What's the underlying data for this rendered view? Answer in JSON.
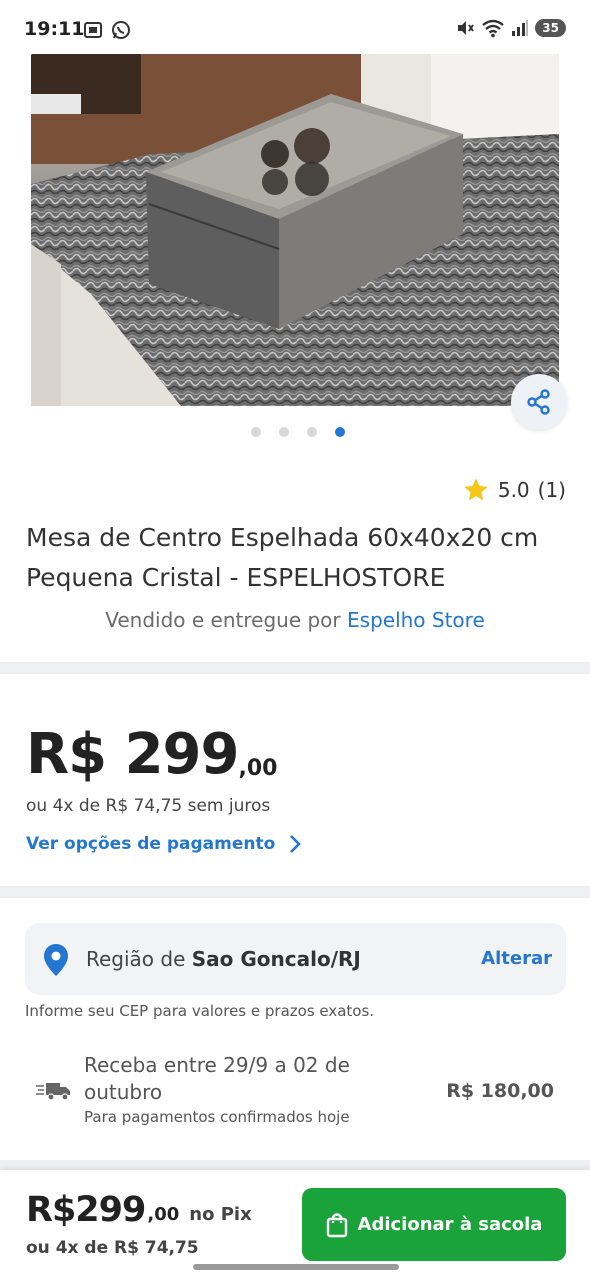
{
  "status_bar": {
    "time": "19:11",
    "battery": "35",
    "left_icons": [
      "screenshot-icon",
      "whatsapp-icon"
    ],
    "right_icons": [
      "mute-icon",
      "wifi-icon",
      "signal-icon",
      "battery-icon"
    ]
  },
  "gallery": {
    "image_count": 4,
    "active_index": 3
  },
  "product": {
    "rating": "5.0",
    "rating_count": "(1)",
    "title": "Mesa de Centro Espelhada 60x40x20 cm Pequena Cristal - ESPELHOSTORE",
    "seller_prefix": "Vendido e entregue por",
    "seller_name": "Espelho Store"
  },
  "pricing": {
    "price_main": "R$ 299",
    "price_cents": ",00",
    "installments": "ou 4x de R$ 74,75 sem juros",
    "payment_options": "Ver opções de pagamento"
  },
  "shipping": {
    "region_prefix": "Região de",
    "region_name": "Sao Goncalo/RJ",
    "change_label": "Alterar",
    "cep_note": "Informe seu CEP para valores e prazos exatos.",
    "delivery_text": "Receba entre 29/9 a 02 de outubro",
    "delivery_sub": "Para pagamentos confirmados hoje",
    "delivery_price": "R$ 180,00"
  },
  "bottom_bar": {
    "price": "R$299",
    "cents": ",00",
    "pix_label": "no Pix",
    "installments": "ou 4x de R$ 74,75",
    "add_button": "Adicionar à sacola"
  },
  "colors": {
    "accent_blue": "#2377d1",
    "button_green": "#1aa33a",
    "star_yellow": "#f5c518"
  }
}
